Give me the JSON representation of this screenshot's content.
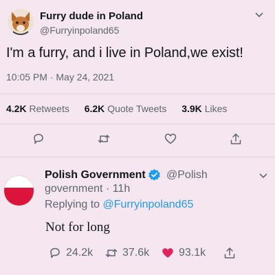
{
  "tweet": {
    "author_name": "Furry dude in Poland",
    "author_handle": "@Furryinpoland65",
    "text": "I'm a furry, and i live in Poland,we exist!",
    "timestamp": "10:05 PM · May 24, 2021",
    "stats": {
      "retweets_count": "4.2K",
      "retweets_label": "Retweets",
      "quotes_count": "6.2K",
      "quotes_label": "Quote Tweets",
      "likes_count": "3.9K",
      "likes_label": "Likes"
    },
    "actions": [
      "reply-icon",
      "retweet-icon",
      "like-icon",
      "share-icon"
    ]
  },
  "reply": {
    "author_name": "Polish Government",
    "author_handle": "@Polish",
    "handle_rest": "government · 11h",
    "replying_prefix": "Replying to ",
    "replying_mention": "@Furryinpoland65",
    "text": "Not for long",
    "counts": {
      "replies": "24.2k",
      "retweets": "37.6k",
      "likes": "93.1k"
    }
  },
  "colors": {
    "background": "#f6e6ef",
    "link": "#1d9bf0",
    "verified": "#1d9bf0",
    "like_active": "#e0245e",
    "flag_red": "#dc143c"
  }
}
